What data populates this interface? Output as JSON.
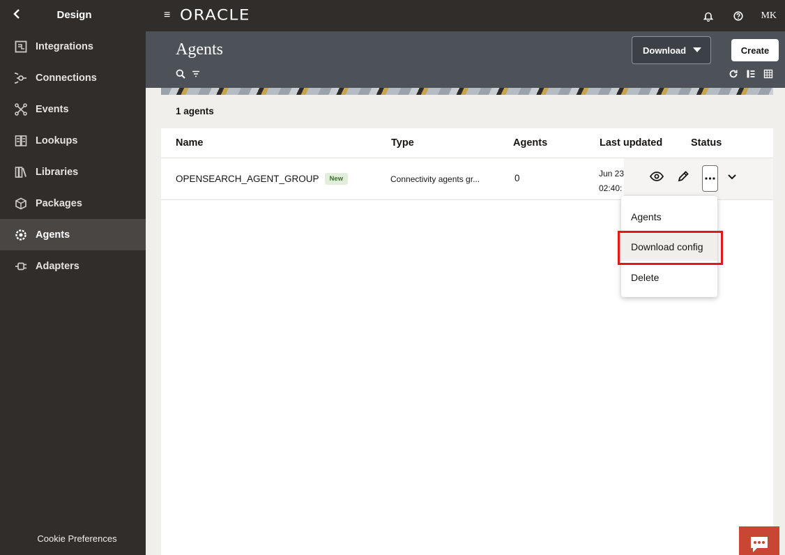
{
  "sidebar": {
    "title": "Design",
    "items": [
      {
        "label": "Integrations",
        "icon": "integrations-icon",
        "active": false
      },
      {
        "label": "Connections",
        "icon": "connections-icon",
        "active": false
      },
      {
        "label": "Events",
        "icon": "events-icon",
        "active": false
      },
      {
        "label": "Lookups",
        "icon": "lookups-icon",
        "active": false
      },
      {
        "label": "Libraries",
        "icon": "libraries-icon",
        "active": false
      },
      {
        "label": "Packages",
        "icon": "packages-icon",
        "active": false
      },
      {
        "label": "Agents",
        "icon": "agents-icon",
        "active": true
      },
      {
        "label": "Adapters",
        "icon": "adapters-icon",
        "active": false
      }
    ],
    "cookie_label": "Cookie Preferences"
  },
  "topbar": {
    "logo": "ORACLE",
    "user_initials": "MK"
  },
  "header": {
    "title": "Agents",
    "download_label": "Download",
    "create_label": "Create"
  },
  "list": {
    "count_label": "1 agents",
    "columns": [
      "Name",
      "Type",
      "Agents",
      "Last updated",
      "Status"
    ],
    "rows": [
      {
        "name": "OPENSEARCH_AGENT_GROUP",
        "badge": "New",
        "type": "Connectivity agents gr...",
        "agents": "0",
        "date_line1": "Jun 23",
        "date_line2": "02:40:"
      }
    ]
  },
  "menu": {
    "items": [
      "Agents",
      "Download config",
      "Delete"
    ],
    "highlighted": "Download config"
  },
  "colors": {
    "sidebar_bg": "#312d2a",
    "header_bg": "#4d5158",
    "highlight_border": "#e01818",
    "chat_bg": "#c74634"
  }
}
